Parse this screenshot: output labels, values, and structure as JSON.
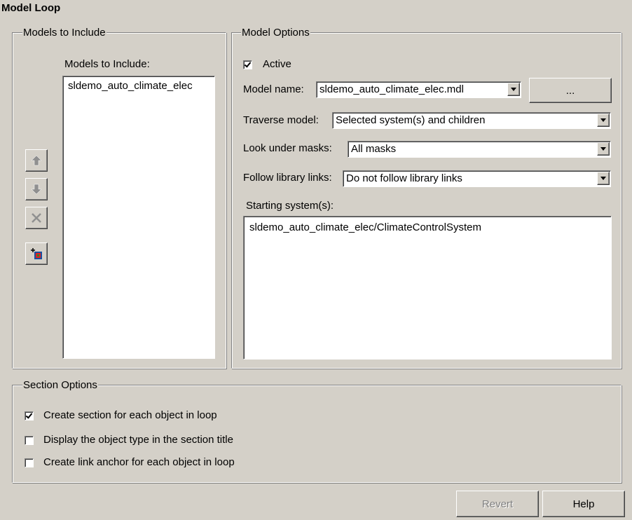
{
  "title": "Model Loop",
  "models_group": {
    "legend": "Models to Include",
    "list_label": "Models to Include:",
    "items": [
      "sldemo_auto_climate_elec"
    ],
    "buttons": [
      {
        "name": "move-up-button",
        "icon": "arrow-up-icon"
      },
      {
        "name": "move-down-button",
        "icon": "arrow-down-icon"
      },
      {
        "name": "remove-button",
        "icon": "delete-x-icon"
      },
      {
        "name": "add-model-button",
        "icon": "add-model-icon"
      }
    ]
  },
  "options_group": {
    "legend": "Model Options",
    "active_label": "Active",
    "active_checked": true,
    "model_name_label": "Model name:",
    "model_name_value": "sldemo_auto_climate_elec.mdl",
    "browse_label": "...",
    "traverse_label": "Traverse model:",
    "traverse_value": "Selected system(s) and children",
    "masks_label": "Look under masks:",
    "masks_value": "All masks",
    "links_label": "Follow library links:",
    "links_value": "Do not follow library links",
    "starting_label": "Starting system(s):",
    "starting_value": "sldemo_auto_climate_elec/ClimateControlSystem"
  },
  "section_group": {
    "legend": "Section Options",
    "checks": [
      {
        "label": "Create section for each object in loop",
        "checked": true
      },
      {
        "label": "Display the object type in the section title",
        "checked": false
      },
      {
        "label": "Create link anchor for each object in loop",
        "checked": false
      }
    ]
  },
  "footer": {
    "revert_label": "Revert",
    "help_label": "Help"
  }
}
